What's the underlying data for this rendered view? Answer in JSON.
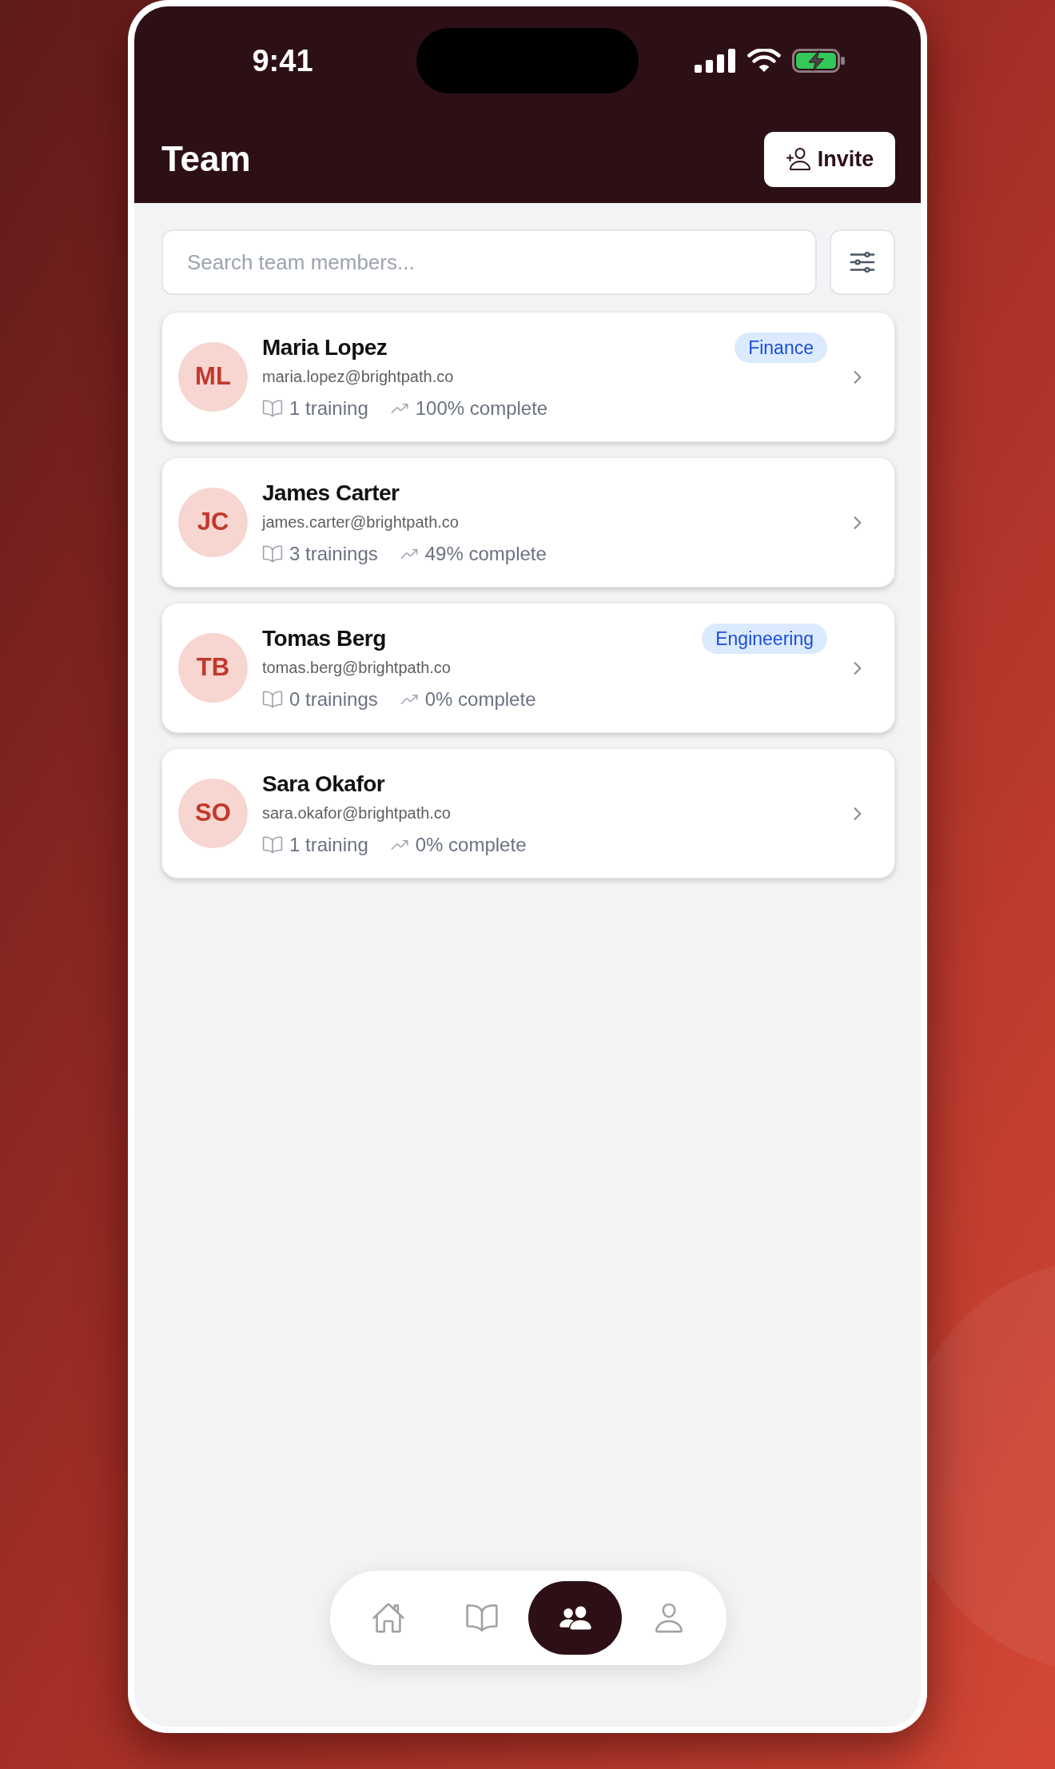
{
  "status_bar": {
    "time": "9:41"
  },
  "header": {
    "title": "Team",
    "invite_button": "Invite"
  },
  "search": {
    "placeholder": "Search team members..."
  },
  "members": [
    {
      "initials": "ML",
      "name": "Maria Lopez",
      "email": "maria.lopez@brightpath.co",
      "department": "Finance",
      "trainings": "1 training",
      "progress": "100% complete"
    },
    {
      "initials": "JC",
      "name": "James Carter",
      "email": "james.carter@brightpath.co",
      "trainings": "3 trainings",
      "progress": "49% complete"
    },
    {
      "initials": "TB",
      "name": "Tomas Berg",
      "email": "tomas.berg@brightpath.co",
      "department": "Engineering",
      "trainings": "0 trainings",
      "progress": "0% complete"
    },
    {
      "initials": "SO",
      "name": "Sara Okafor",
      "email": "sara.okafor@brightpath.co",
      "trainings": "1 training",
      "progress": "0% complete"
    }
  ],
  "bottom_nav": [
    {
      "kind": "home",
      "selected": false
    },
    {
      "kind": "book",
      "selected": false
    },
    {
      "kind": "team",
      "selected": true
    },
    {
      "kind": "profile",
      "selected": false
    }
  ]
}
